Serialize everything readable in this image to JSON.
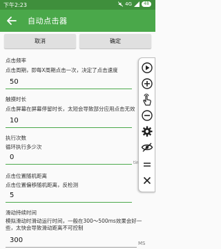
{
  "status_bar": {
    "time": "下午2:23",
    "network": "4G",
    "battery": "48"
  },
  "app_bar": {
    "title": "自动点击器"
  },
  "buttons": {
    "cancel": "取消",
    "confirm": "确定"
  },
  "settings": [
    {
      "title": "点击频率",
      "desc": "点击周期，即每X周期点击一次，决定了点击速度",
      "value": "50",
      "unit": ""
    },
    {
      "title": "触摸时长",
      "desc": "点击屏幕在屏幕停留时长，太短会导致部分应用点击无效",
      "value": "10",
      "unit": ""
    },
    {
      "title": "执行次数",
      "desc": "循环执行多少次",
      "value": "0",
      "unit": "times"
    },
    {
      "title": "点击位置随机距离",
      "desc": "点击位置偏移随机距离，反检测",
      "value": "5",
      "unit": ""
    },
    {
      "title": "滑动持续时间",
      "desc": "模拟滑动时滑动运行时间，一般在300～500ms效果会好一些，太快会导致滑动距离不可控制",
      "desc2": "些，太快会导致滑动距离不可控制",
      "value": "300",
      "unit": "MS"
    }
  ],
  "toolbar_icons": [
    "play-icon",
    "add-circle-icon",
    "touch-icon",
    "remove-circle-icon",
    "gear-icon",
    "eye-off-icon",
    "menu-icon",
    "close-icon"
  ],
  "colors": {
    "status_bar": "#3f8f3c",
    "app_bar": "#4aa84a",
    "accent": "#4aa84a"
  }
}
